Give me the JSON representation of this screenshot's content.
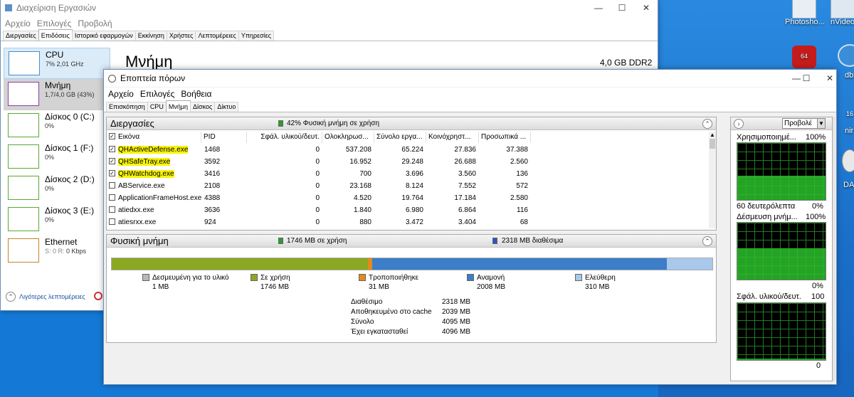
{
  "desktop": {
    "icons": [
      {
        "label": "Photosho...",
        "icon": "photoshop-icon"
      },
      {
        "label": "nVideo",
        "icon": "nvidia-icon"
      }
    ],
    "badge": "64",
    "edge_labels": [
      "dbx",
      "16",
      "nir",
      "DA"
    ]
  },
  "task_manager": {
    "title": "Διαχείριση Εργασιών",
    "menu": [
      "Αρχείο",
      "Επιλογές",
      "Προβολή"
    ],
    "tabs": [
      "Διεργασίες",
      "Επιδόσεις",
      "Ιστορικό εφαρμογών",
      "Εκκίνηση",
      "Χρήστες",
      "Λεπτομέρειες",
      "Υπηρεσίες"
    ],
    "active_tab": "Επιδόσεις",
    "sidebar": [
      {
        "name": "CPU",
        "sub": "7% 2,01 GHz",
        "color": "#4a8cd0"
      },
      {
        "name": "Μνήμη",
        "sub": "1,7/4,0 GB (43%)",
        "color": "#8b3fa8"
      },
      {
        "name": "Δίσκος 0 (C:)",
        "sub": "0%",
        "color": "#5aa832"
      },
      {
        "name": "Δίσκος 1 (F:)",
        "sub": "0%",
        "color": "#5aa832"
      },
      {
        "name": "Δίσκος 2 (D:)",
        "sub": "0%",
        "color": "#5aa832"
      },
      {
        "name": "Δίσκος 3 (E:)",
        "sub": "0%",
        "color": "#5aa832"
      },
      {
        "name": "Ethernet",
        "sub_prefix": "S: 0 R: ",
        "sub": "0 Kbps",
        "color": "#c8822d"
      }
    ],
    "main_title": "Μνήμη",
    "main_spec": "4,0 GB DDR2",
    "fewer_details": "Λιγότερες λεπτομέρειες"
  },
  "resource_monitor": {
    "title": "Εποπτεία πόρων",
    "menu": [
      "Αρχείο",
      "Επιλογές",
      "Βοήθεια"
    ],
    "tabs": [
      "Επισκόπηση",
      "CPU",
      "Μνήμη",
      "Δίσκος",
      "Δίκτυο"
    ],
    "active_tab": "Μνήμη",
    "processes": {
      "title": "Διεργασίες",
      "status": "42% Φυσική μνήμη σε χρήση",
      "columns": [
        "Εικόνα",
        "PID",
        "Σφάλ. υλικού/δευτ.",
        "Ολοκληρωσ...",
        "Σύνολο εργα...",
        "Κοινόχρηστ...",
        "Προσωπικά ..."
      ],
      "rows": [
        {
          "checked": true,
          "highlight": true,
          "name": "QHActiveDefense.exe",
          "pid": "1468",
          "faults": "0",
          "commit": "537.208",
          "working": "65.224",
          "shared": "27.836",
          "private": "37.388"
        },
        {
          "checked": true,
          "highlight": true,
          "name": "QHSafeTray.exe",
          "pid": "3592",
          "faults": "0",
          "commit": "16.952",
          "working": "29.248",
          "shared": "26.688",
          "private": "2.560"
        },
        {
          "checked": true,
          "highlight": true,
          "name": "QHWatchdog.exe",
          "pid": "3416",
          "faults": "0",
          "commit": "700",
          "working": "3.696",
          "shared": "3.560",
          "private": "136"
        },
        {
          "checked": false,
          "highlight": false,
          "name": "ABService.exe",
          "pid": "2108",
          "faults": "0",
          "commit": "23.168",
          "working": "8.124",
          "shared": "7.552",
          "private": "572"
        },
        {
          "checked": false,
          "highlight": false,
          "name": "ApplicationFrameHost.exe",
          "pid": "4388",
          "faults": "0",
          "commit": "4.520",
          "working": "19.764",
          "shared": "17.184",
          "private": "2.580"
        },
        {
          "checked": false,
          "highlight": false,
          "name": "atiedxx.exe",
          "pid": "3636",
          "faults": "0",
          "commit": "1.840",
          "working": "6.980",
          "shared": "6.864",
          "private": "116"
        },
        {
          "checked": false,
          "highlight": false,
          "name": "atiesrxx.exe",
          "pid": "924",
          "faults": "0",
          "commit": "880",
          "working": "3.472",
          "shared": "3.404",
          "private": "68"
        }
      ]
    },
    "physical": {
      "title": "Φυσική μνήμη",
      "in_use": "1746 MB σε χρήση",
      "available": "2318 MB διαθέσιμα",
      "bar": [
        {
          "label": "Δεσμευμένη για το υλικό",
          "value": "1 MB",
          "mb": 1,
          "color": "#b8b8b8"
        },
        {
          "label": "Σε χρήση",
          "value": "1746 MB",
          "mb": 1746,
          "color": "#8aa822"
        },
        {
          "label": "Τροποποιήθηκε",
          "value": "31 MB",
          "mb": 31,
          "color": "#e48a1c"
        },
        {
          "label": "Αναμονή",
          "value": "2008 MB",
          "mb": 2008,
          "color": "#3c7ec8"
        },
        {
          "label": "Ελεύθερη",
          "value": "310 MB",
          "mb": 310,
          "color": "#a8c8ec"
        }
      ],
      "summary": [
        {
          "label": "Διαθέσιμο",
          "value": "2318 MB"
        },
        {
          "label": "Αποθηκευμένο στο cache",
          "value": "2039 MB"
        },
        {
          "label": "Σύνολο",
          "value": "4095 MB"
        },
        {
          "label": "Έχει εγκατασταθεί",
          "value": "4096 MB"
        }
      ]
    },
    "graphs": {
      "view_label": "Προβολέ",
      "g1_title": "Χρησιμοποιημέ...",
      "g1_max": "100%",
      "g1_time": "60 δευτερόλεπτα",
      "g1_min": "0%",
      "g1_level": 0.42,
      "g2_title": "Δέσμευση μνήμ...",
      "g2_max": "100%",
      "g2_min": "0%",
      "g2_level": 0.55,
      "g3_title": "Σφάλ. υλικού/δευτ.",
      "g3_max": "100",
      "g3_min": "0",
      "g3_level": 0.02
    }
  }
}
